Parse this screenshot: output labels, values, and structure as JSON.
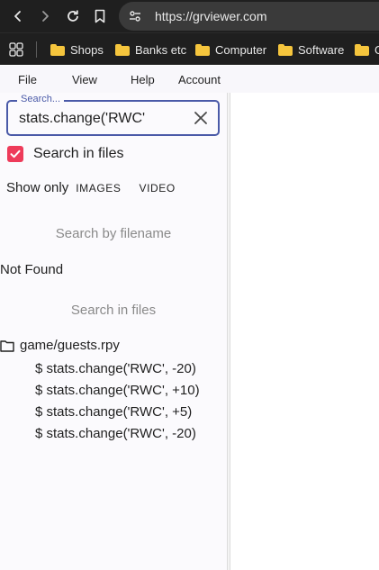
{
  "browser": {
    "url": "https://grviewer.com",
    "bookmarks": [
      "Shops",
      "Banks etc",
      "Computer",
      "Software",
      "G"
    ]
  },
  "menu": [
    "File",
    "View",
    "Help",
    "Account"
  ],
  "search": {
    "label": "Search...",
    "value": "stats.change('RWC'"
  },
  "search_in_files": {
    "label": "Search in files",
    "checked": true
  },
  "show_only": {
    "label": "Show only",
    "options": [
      "IMAGES",
      "VIDEO"
    ]
  },
  "filename_section": {
    "header": "Search by filename",
    "result": "Not Found"
  },
  "files_section": {
    "header": "Search in files",
    "results": [
      {
        "file": "game/guests.rpy",
        "matches": [
          "$ stats.change('RWC', -20)",
          "$ stats.change('RWC', +10)",
          "$ stats.change('RWC', +5)",
          "$ stats.change('RWC', -20)"
        ]
      }
    ]
  },
  "colors": {
    "accent": "#4a5aa8",
    "checkbox": "#ee3b5a",
    "folder": "#f5c53d",
    "chrome": "#1f1f1f"
  }
}
